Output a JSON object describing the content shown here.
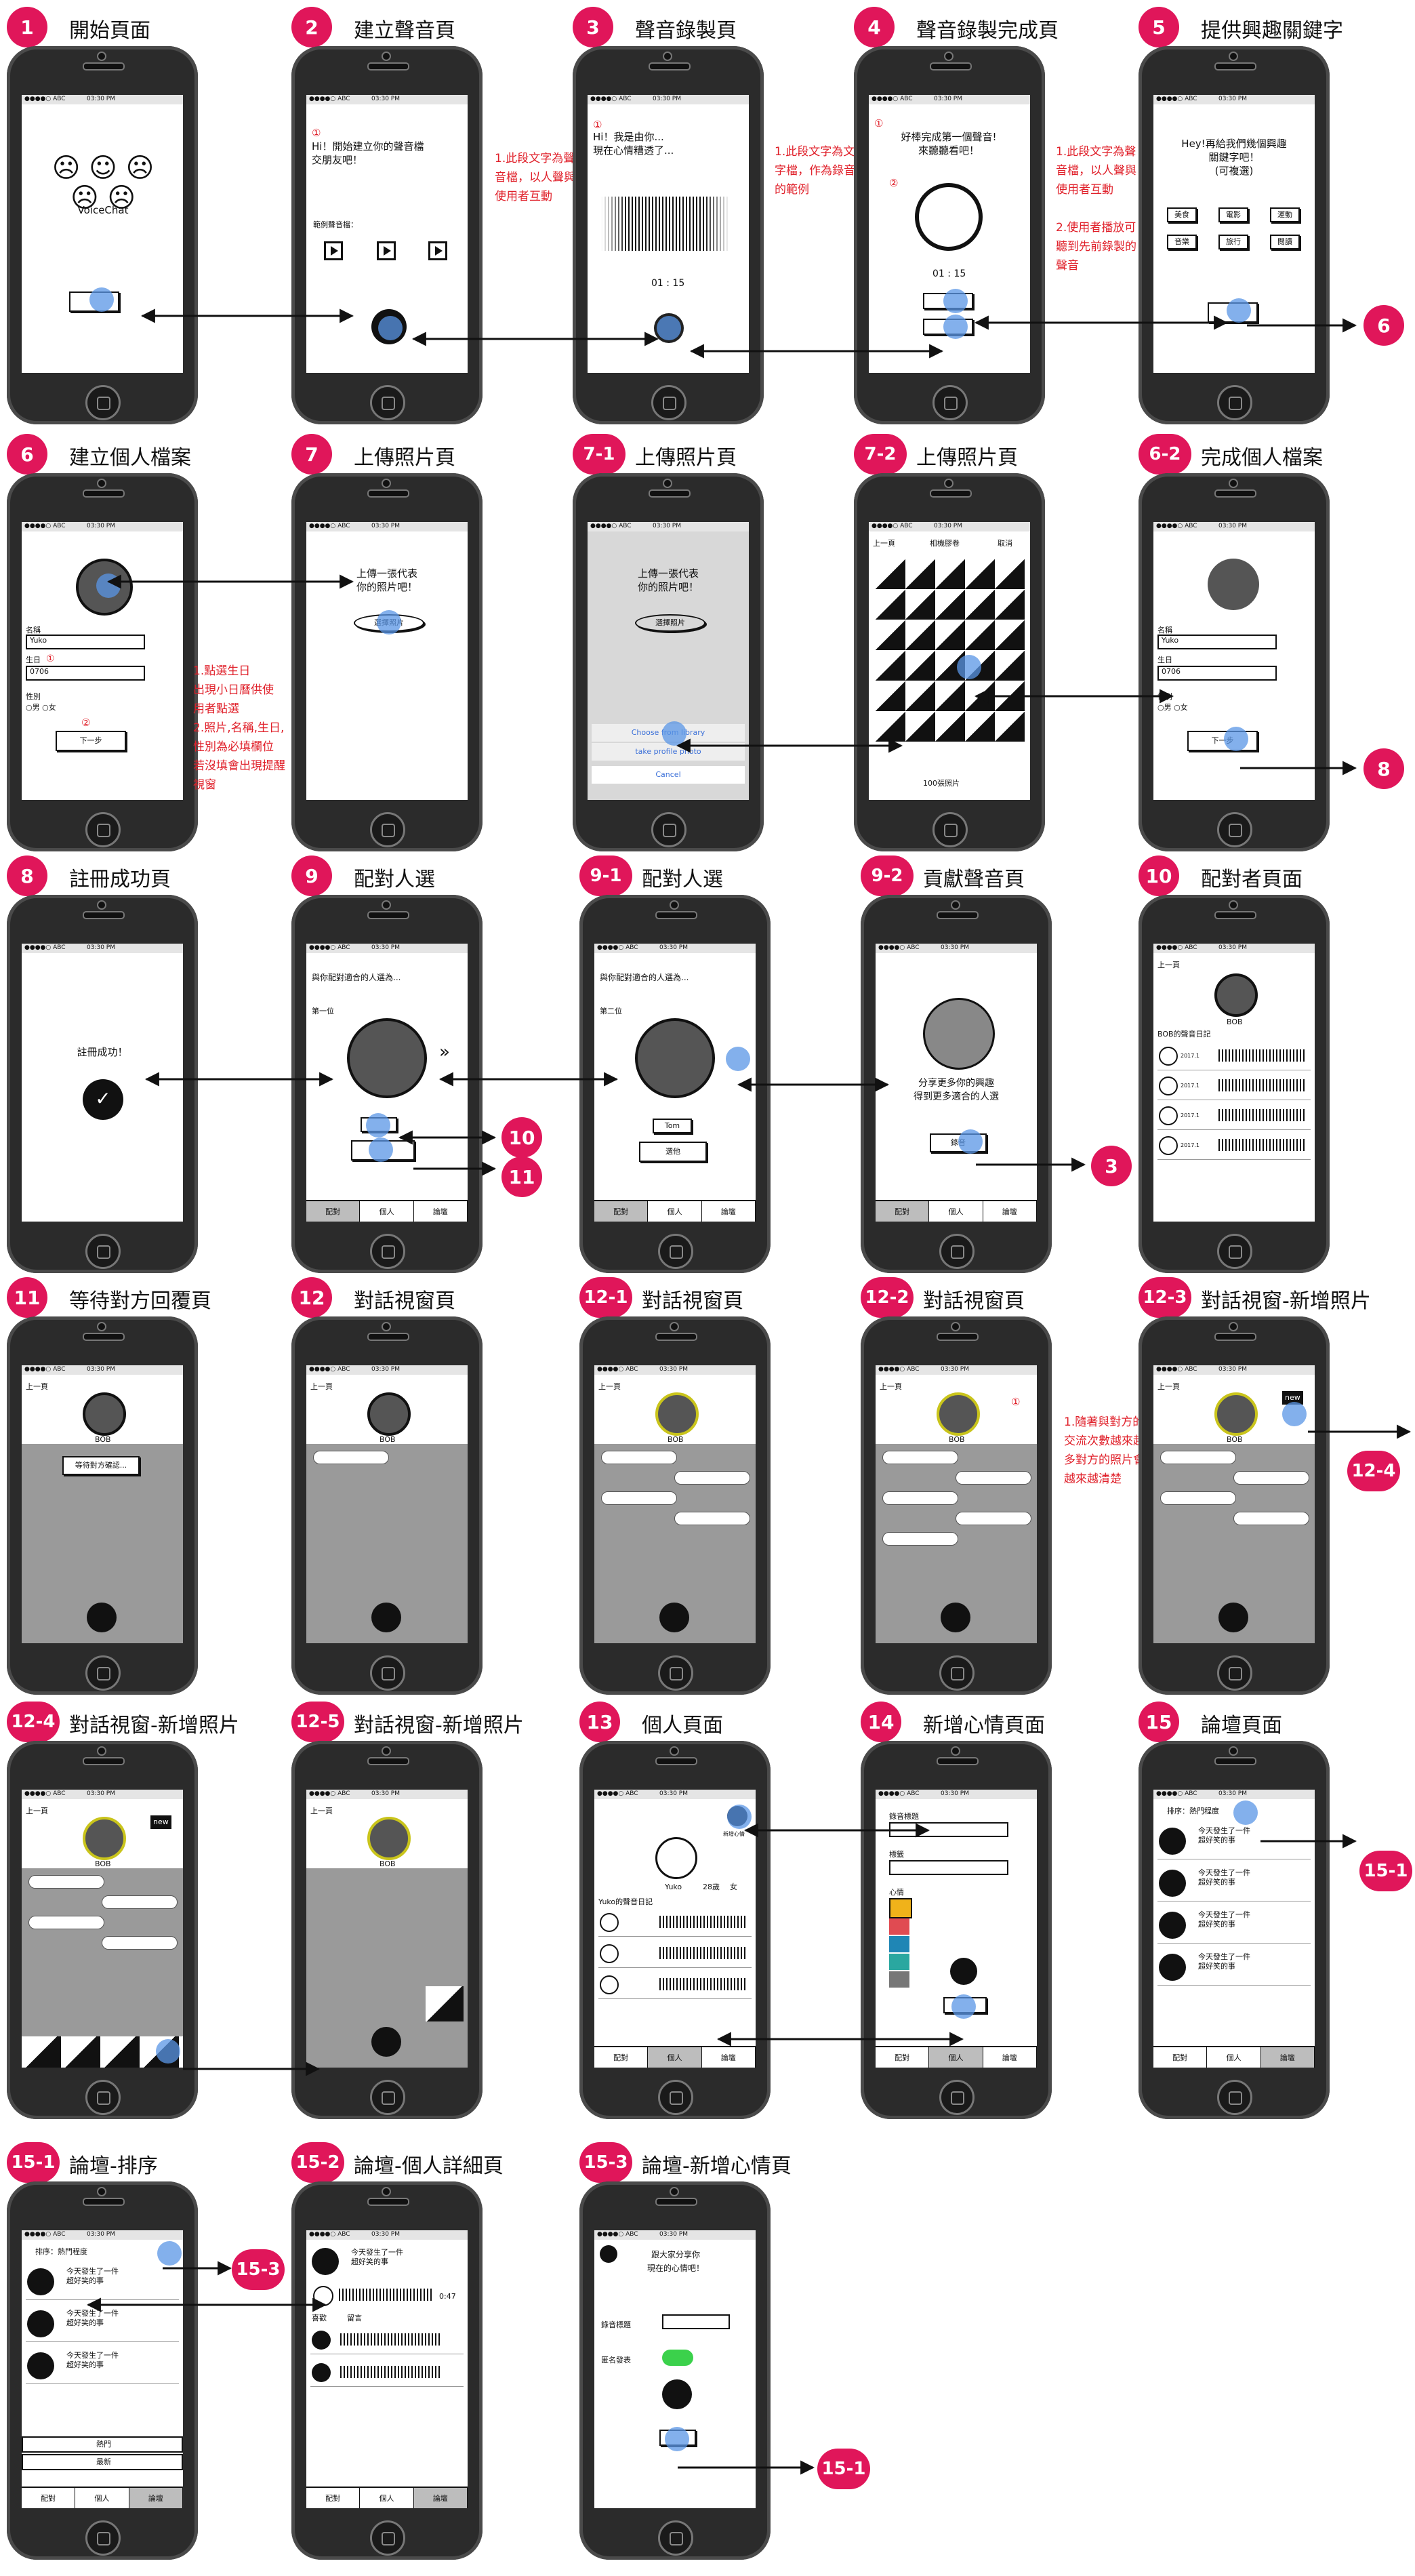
{
  "screens": [
    {
      "id": "1",
      "title": "開始頁面",
      "app_name": "VoiceChat"
    },
    {
      "id": "2",
      "title": "建立聲音頁",
      "marker": "①",
      "greeting": "Hi！開始建立你的聲音檔\n交朋友吧！",
      "sample_label": "範例聲音檔：",
      "note": "1.此段文字為聲\n音檔，以人聲與\n使用者互動"
    },
    {
      "id": "3",
      "title": "聲音錄製頁",
      "marker": "①",
      "prompt": "Hi！我是由你...\n現在心情糟透了...",
      "timer": "01 : 15",
      "note": "1.此段文字為文\n字檔，作為錄音\n的範例"
    },
    {
      "id": "4",
      "title": "聲音錄製完成頁",
      "marker1": "①",
      "marker2": "②",
      "message": "好棒完成第一個聲音!\n來聽聽看吧！",
      "timer": "01 : 15",
      "note": "1.此段文字為聲\n音檔，以人聲與\n使用者互動\n\n2.使用者播放可\n聽到先前錄製的\n聲音"
    },
    {
      "id": "5",
      "title": "提供興趣關鍵字",
      "prompt": "Hey!再給我們幾個興趣\n關鍵字吧！\n(可複選)",
      "tags": [
        "美食",
        "電影",
        "運動",
        "音樂",
        "旅行",
        "閱讀"
      ]
    },
    {
      "id": "6",
      "title": "建立個人檔案",
      "name_label": "名稱",
      "name_value": "Yuko",
      "birthday_label": "生日",
      "birthday_marker": "①",
      "birthday_value": "0706",
      "gender_label": "性別",
      "gender_options": "○男 ○女",
      "marker2": "②",
      "next_button": "下一步",
      "note": "1.點選生日\n出現小日曆供使\n用者點選\n2.照片,名稱,生日,\n性別為必填欄位\n若沒填會出現提醒\n視窗"
    },
    {
      "id": "7",
      "title": "上傳照片頁",
      "prompt": "上傳一張代表\n你的照片吧！",
      "button": "選擇照片"
    },
    {
      "id": "7-1",
      "title": "上傳照片頁",
      "prompt": "上傳一張代表\n你的照片吧！",
      "button": "選擇照片",
      "sheet": [
        "Choose from library",
        "take profile photo",
        "Cancel"
      ]
    },
    {
      "id": "7-2",
      "title": "上傳照片頁",
      "back": "上一頁",
      "album": "相機膠卷",
      "cancel": "取消",
      "count": "100張照片"
    },
    {
      "id": "6-2",
      "title": "完成個人檔案",
      "name_label": "名稱",
      "name_value": "Yuko",
      "birthday_label": "生日",
      "birthday_value": "0706",
      "gender_label": "性別",
      "gender_options": "○男 ○女",
      "next_button": "下一步"
    },
    {
      "id": "8",
      "title": "註冊成功頁",
      "message": "註冊成功！"
    },
    {
      "id": "9",
      "title": "配對人選",
      "heading": "與你配對適合的人選為...",
      "rank": "第一位"
    },
    {
      "id": "9-1",
      "title": "配對人選",
      "heading": "與你配對適合的人選為...",
      "rank": "第二位",
      "name": "Tom",
      "button": "選他"
    },
    {
      "id": "9-2",
      "title": "貢獻聲音頁",
      "message": "分享更多你的興趣\n得到更多適合的人選",
      "button": "錄音"
    },
    {
      "id": "10",
      "title": "配對者頁面",
      "back": "上一頁",
      "name": "BOB",
      "diary": "BOB的聲音日記",
      "dates": [
        "2017.1",
        "2017.1",
        "2017.1",
        "2017.1"
      ]
    },
    {
      "id": "11",
      "title": "等待對方回覆頁",
      "back": "上一頁",
      "name": "BOB",
      "waiting": "等待對方確認..."
    },
    {
      "id": "12",
      "title": "對話視窗頁",
      "back": "上一頁",
      "name": "BOB"
    },
    {
      "id": "12-1",
      "title": "對話視窗頁",
      "back": "上一頁",
      "name": "BOB"
    },
    {
      "id": "12-2",
      "title": "對話視窗頁",
      "back": "上一頁",
      "name": "BOB",
      "marker": "①",
      "note": "1.隨著與對方的\n交流次數越來越\n多對方的照片會\n越來越清楚"
    },
    {
      "id": "12-3",
      "title": "對話視窗-新增照片",
      "back": "上一頁",
      "name": "BOB",
      "new": "new"
    },
    {
      "id": "12-4",
      "title": "對話視窗-新增照片",
      "back": "上一頁",
      "name": "BOB",
      "new": "new"
    },
    {
      "id": "12-5",
      "title": "對話視窗-新增照片",
      "back": "上一頁",
      "name": "BOB"
    },
    {
      "id": "13",
      "title": "個人頁面",
      "name": "Yuko",
      "age": "28歲",
      "gender": "女",
      "diary": "Yuko的聲音日記",
      "new_label": "新增心情"
    },
    {
      "id": "14",
      "title": "新增心情頁面",
      "label1": "錄音標題",
      "label2": "標籤",
      "label3": "心情"
    },
    {
      "id": "15",
      "title": "論壇頁面",
      "sort": "排序：熱門程度",
      "post": "今天發生了一件\n超好笑的事"
    },
    {
      "id": "15-1",
      "title": "論壇-排序",
      "sort": "排序：熱門程度",
      "post": "今天發生了一件\n超好笑的事",
      "option1": "熱門",
      "option2": "最新"
    },
    {
      "id": "15-2",
      "title": "論壇-個人詳細頁",
      "post": "今天發生了一件\n超好笑的事",
      "time": "0:47",
      "like": "喜歡",
      "comment": "留言"
    },
    {
      "id": "15-3",
      "title": "論壇-新增心情頁",
      "prompt": "跟大家分享你\n現在的心情吧！",
      "label1": "錄音標題",
      "label2": "匿名發表"
    }
  ],
  "tabs": [
    "配對",
    "個人",
    "論壇"
  ],
  "status": {
    "carrier": "●●●●○ ABC",
    "time": "03:30 PM"
  },
  "link_badges": [
    "6",
    "8",
    "10",
    "11",
    "3",
    "12-4",
    "15-1",
    "15-3",
    "15-1"
  ],
  "colors": {
    "badge": "#e0165a",
    "note": "#e0202a",
    "touch": "#5a96e6"
  }
}
